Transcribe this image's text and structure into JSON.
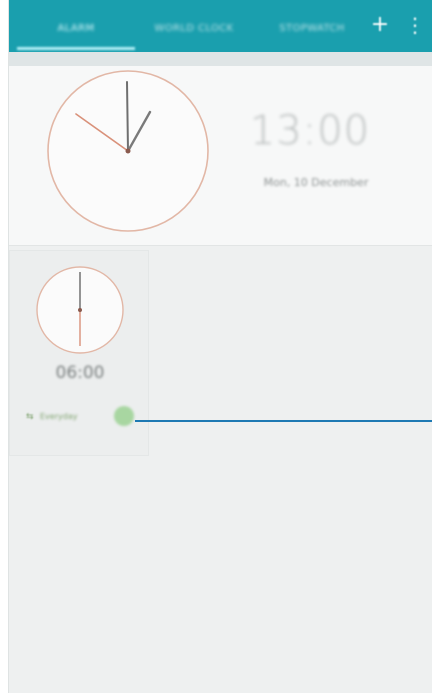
{
  "tabs": [
    {
      "label": "ALARM",
      "active": true
    },
    {
      "label": "WORLD CLOCK",
      "active": false
    },
    {
      "label": "STOPWATCH",
      "active": false
    }
  ],
  "toolbar": {
    "add_label": "+",
    "more_label": "⋮"
  },
  "main_clock": {
    "digital_time": "13:00",
    "date": "Mon, 10 December"
  },
  "alarm": {
    "time": "06:00",
    "label": "Everyday",
    "repeat_icon": "repeat-icon",
    "enabled": true
  },
  "colors": {
    "accent": "#1a9fae",
    "tab_indicator": "#b6f0f7",
    "callout": "#1e79b3",
    "toggle_on": "#a8d6a1"
  }
}
